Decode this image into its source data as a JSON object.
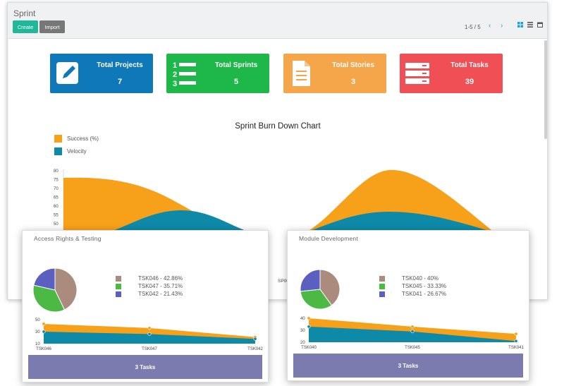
{
  "app": {
    "title": "Sprint",
    "create_label": "Create",
    "import_label": "Import",
    "pager": "1-5 / 5"
  },
  "cards": [
    {
      "label": "Total Projects",
      "value": "7",
      "color": "#0e78b8",
      "icon": "pencil-icon"
    },
    {
      "label": "Total Sprints",
      "value": "5",
      "color": "#1eb84a",
      "icon": "numbered-list-icon"
    },
    {
      "label": "Total Stories",
      "value": "3",
      "color": "#f5a54a",
      "icon": "document-icon"
    },
    {
      "label": "Total Tasks",
      "value": "39",
      "color": "#ef4f55",
      "icon": "server-icon"
    }
  ],
  "chart_data": [
    {
      "type": "area",
      "title": "Sprint Burn Down Chart",
      "series": [
        {
          "name": "Success (%)",
          "color": "#f7a11a"
        },
        {
          "name": "Velocity",
          "color": "#0e8aa8"
        }
      ],
      "y_ticks": [
        80,
        75,
        70,
        65,
        60,
        55,
        50,
        45
      ],
      "x_labels": [
        "SP003"
      ],
      "legend_position": "top-left"
    },
    {
      "type": "pie",
      "panel": "Access Rights & Testing",
      "slices": [
        {
          "label": "TSK046 - 42.86%",
          "value": 42.86,
          "color": "#ab8b7e"
        },
        {
          "label": "TSK047 - 35.71%",
          "value": 35.71,
          "color": "#4cb944"
        },
        {
          "label": "TSK042 - 21.43%",
          "value": 21.43,
          "color": "#5b5fc0"
        }
      ]
    },
    {
      "type": "area",
      "panel": "Access Rights & Testing",
      "categories": [
        "TSK046",
        "TSK047",
        "TSK042"
      ],
      "y_ticks": [
        50,
        30,
        10
      ],
      "ylim": [
        10,
        50
      ],
      "series": [
        {
          "color": "#f7a11a",
          "values": [
            43,
            36,
            21
          ]
        },
        {
          "color": "#0e8aa8",
          "values": [
            30,
            26,
            18
          ]
        }
      ]
    },
    {
      "type": "pie",
      "panel": "Module Development",
      "slices": [
        {
          "label": "TSK040 - 40%",
          "value": 40,
          "color": "#ab8b7e"
        },
        {
          "label": "TSK045 - 33.33%",
          "value": 33.33,
          "color": "#4cb944"
        },
        {
          "label": "TSK041 - 26.67%",
          "value": 26.67,
          "color": "#5b5fc0"
        }
      ]
    },
    {
      "type": "area",
      "panel": "Module Development",
      "categories": [
        "TSK040",
        "TSK045",
        "TSK041"
      ],
      "y_ticks": [
        40,
        30,
        20
      ],
      "ylim": [
        20,
        40
      ],
      "series": [
        {
          "color": "#f7a11a",
          "values": [
            40,
            33,
            27
          ]
        },
        {
          "color": "#0e8aa8",
          "values": [
            33,
            29,
            21
          ]
        }
      ]
    }
  ],
  "panels": [
    {
      "title": "Access Rights & Testing",
      "footer": "3 Tasks"
    },
    {
      "title": "Module Development",
      "footer": "3 Tasks"
    }
  ]
}
